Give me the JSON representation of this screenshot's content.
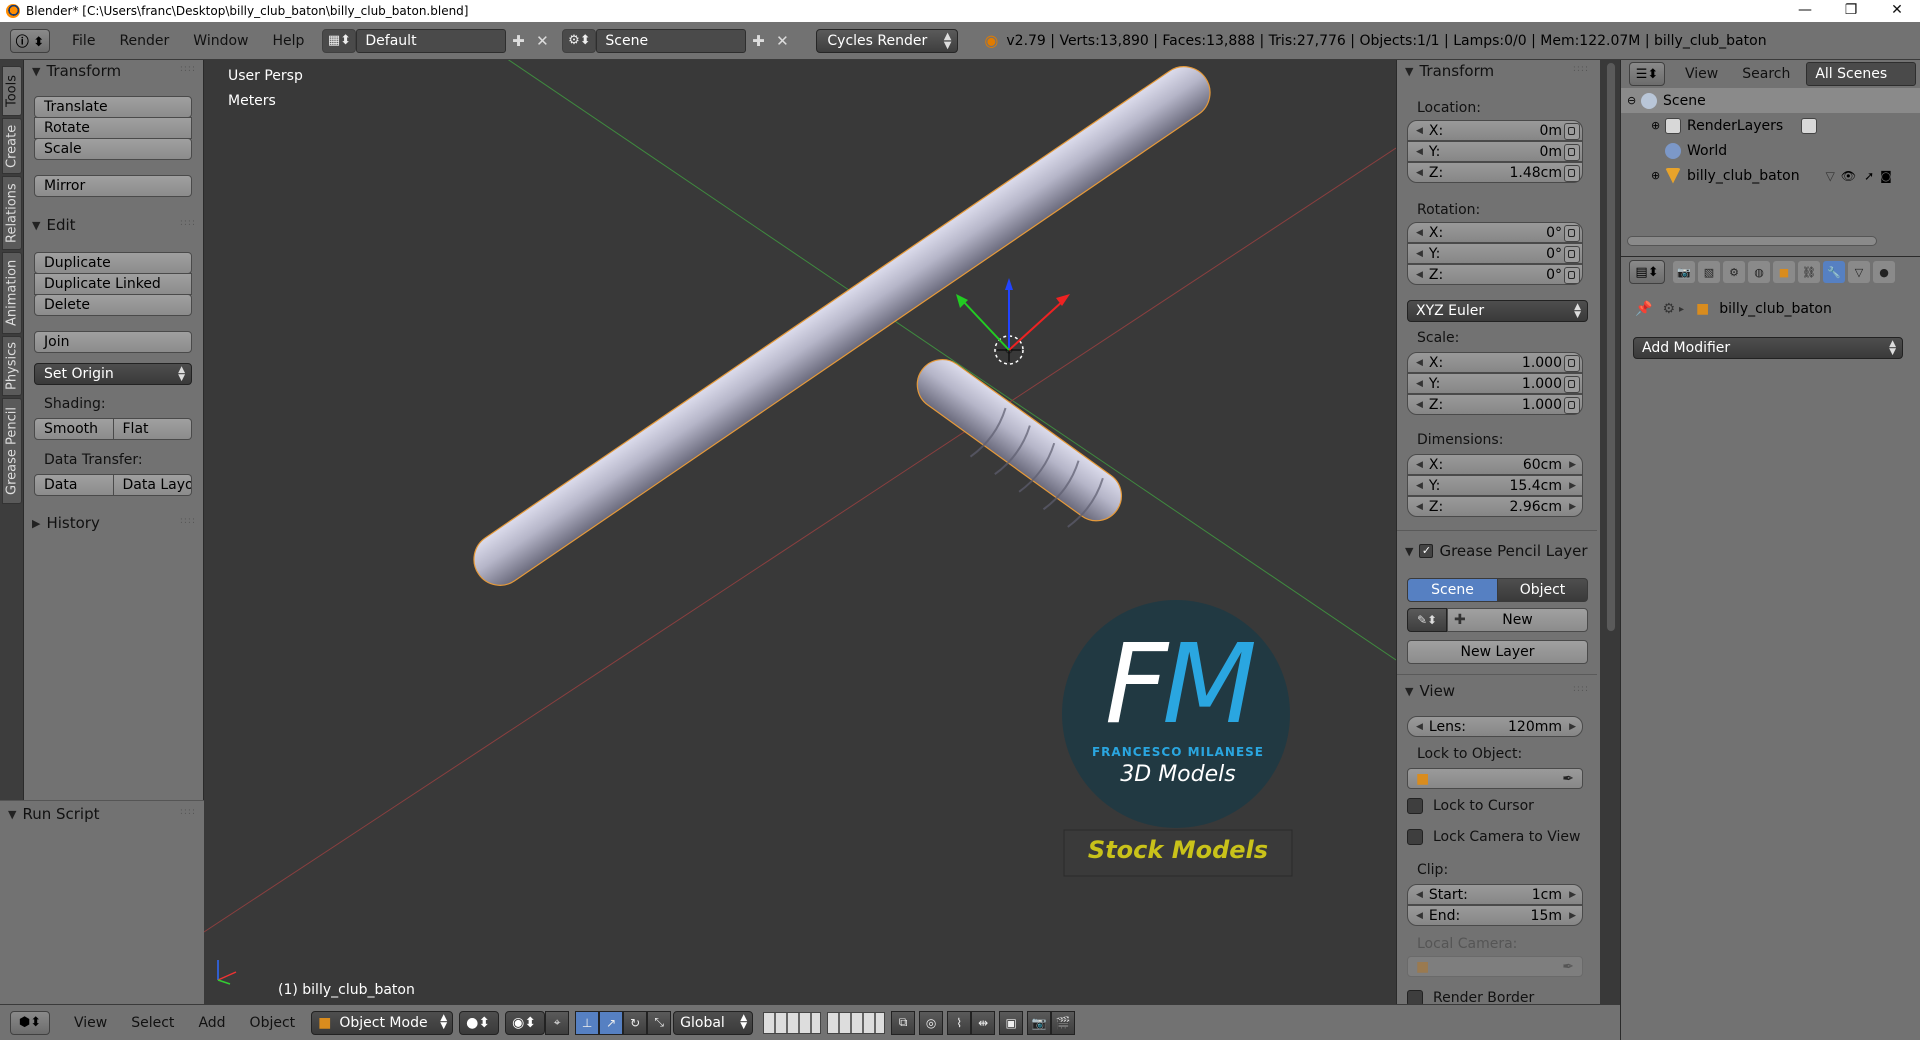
{
  "window": {
    "title": "Blender* [C:\\Users\\franc\\Desktop\\billy_club_baton\\billy_club_baton.blend]",
    "minimize": "—",
    "maximize": "❐",
    "close": "✕"
  },
  "infobar": {
    "menus": [
      "File",
      "Render",
      "Window",
      "Help"
    ],
    "screen_layout": "Default",
    "scene": "Scene",
    "render_engine": "Cycles Render",
    "stats": "v2.79 | Verts:13,890 | Faces:13,888 | Tris:27,776 | Objects:1/1 | Lamps:0/0 | Mem:122.07M | billy_club_baton"
  },
  "tool_tabs": [
    "Tools",
    "Create",
    "Relations",
    "Animation",
    "Physics",
    "Grease Pencil"
  ],
  "toolshelf": {
    "transform_title": "Transform",
    "transform_buttons": [
      "Translate",
      "Rotate",
      "Scale"
    ],
    "mirror": "Mirror",
    "edit_title": "Edit",
    "edit_buttons": [
      "Duplicate",
      "Duplicate Linked",
      "Delete"
    ],
    "join": "Join",
    "set_origin": "Set Origin",
    "shading_label": "Shading:",
    "shading_smooth": "Smooth",
    "shading_flat": "Flat",
    "data_transfer_label": "Data Transfer:",
    "data_btn": "Data",
    "data_layout_btn": "Data Layo",
    "history_title": "History",
    "run_script_title": "Run Script"
  },
  "viewport": {
    "view_name": "User Persp",
    "units": "Meters",
    "active_object_label": "(1) billy_club_baton",
    "watermark": {
      "logo_letters": "FM",
      "name": "FRANCESCO MILANESE",
      "subtitle": "3D Models",
      "banner": "Stock Models",
      "colors": {
        "circle": "#1f3a44",
        "banner_text": "#c9c21a",
        "m_accent": "#2aa6e0"
      }
    }
  },
  "npanel": {
    "transform_title": "Transform",
    "location_label": "Location:",
    "location": [
      {
        "axis": "X:",
        "value": "0m"
      },
      {
        "axis": "Y:",
        "value": "0m"
      },
      {
        "axis": "Z:",
        "value": "1.48cm"
      }
    ],
    "rotation_label": "Rotation:",
    "rotation": [
      {
        "axis": "X:",
        "value": "0°"
      },
      {
        "axis": "Y:",
        "value": "0°"
      },
      {
        "axis": "Z:",
        "value": "0°"
      }
    ],
    "rotation_mode": "XYZ Euler",
    "scale_label": "Scale:",
    "scale": [
      {
        "axis": "X:",
        "value": "1.000"
      },
      {
        "axis": "Y:",
        "value": "1.000"
      },
      {
        "axis": "Z:",
        "value": "1.000"
      }
    ],
    "dimensions_label": "Dimensions:",
    "dimensions": [
      {
        "axis": "X:",
        "value": "60cm"
      },
      {
        "axis": "Y:",
        "value": "15.4cm"
      },
      {
        "axis": "Z:",
        "value": "2.96cm"
      }
    ],
    "grease_title": "Grease Pencil Layer",
    "grease_scene": "Scene",
    "grease_object": "Object",
    "grease_new": "New",
    "grease_new_layer": "New Layer",
    "view_title": "View",
    "lens_label": "Lens:",
    "lens_value": "120mm",
    "lock_to_object_label": "Lock to Object:",
    "lock_to_cursor": "Lock to Cursor",
    "lock_camera": "Lock Camera to View",
    "clip_label": "Clip:",
    "clip_start_label": "Start:",
    "clip_start": "1cm",
    "clip_end_label": "End:",
    "clip_end": "15m",
    "local_camera_label": "Local Camera:",
    "render_border": "Render Border"
  },
  "outliner": {
    "menu_view": "View",
    "menu_search": "Search",
    "filter": "All Scenes",
    "rows": [
      "Scene",
      "RenderLayers",
      "World",
      "billy_club_baton"
    ]
  },
  "properties": {
    "object_name": "billy_club_baton",
    "add_modifier": "Add Modifier"
  },
  "bottombar": {
    "menus": [
      "View",
      "Select",
      "Add",
      "Object"
    ],
    "mode": "Object Mode",
    "orientation": "Global"
  }
}
